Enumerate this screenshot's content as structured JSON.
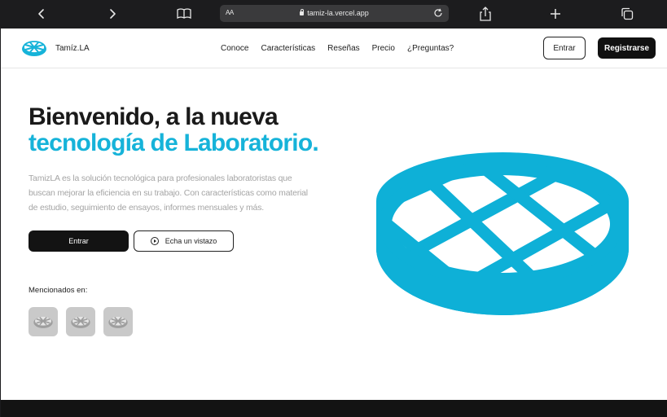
{
  "browser": {
    "url": "tamiz-la.vercel.app",
    "reader_label": "AA",
    "icons": [
      "back-icon",
      "forward-icon",
      "bookmarks-icon",
      "reload-icon",
      "share-icon",
      "new-tab-icon",
      "tabs-icon"
    ]
  },
  "navbar": {
    "brand": "Tamíz.LA",
    "links": [
      "Conoce",
      "Características",
      "Reseñas",
      "Precio",
      "¿Preguntas?"
    ],
    "login_label": "Entrar",
    "register_label": "Registrarse"
  },
  "hero": {
    "title_line1": "Bienvenido, a la nueva",
    "title_line2": "tecnología de Laboratorio.",
    "description": "TamizLA es la solución tecnológica para profesionales laboratoristas que buscan mejorar la eficiencia en su trabajo. Con características como material de estudio, seguimiento de ensayos, informes mensuales y más.",
    "primary_button": "Entrar",
    "secondary_button": "Echa un vistazo",
    "mentioned_label": "Mencionados en:"
  },
  "colors": {
    "accent": "#16b3d9",
    "dark": "#131313",
    "muted_text": "#a5a5a5"
  }
}
